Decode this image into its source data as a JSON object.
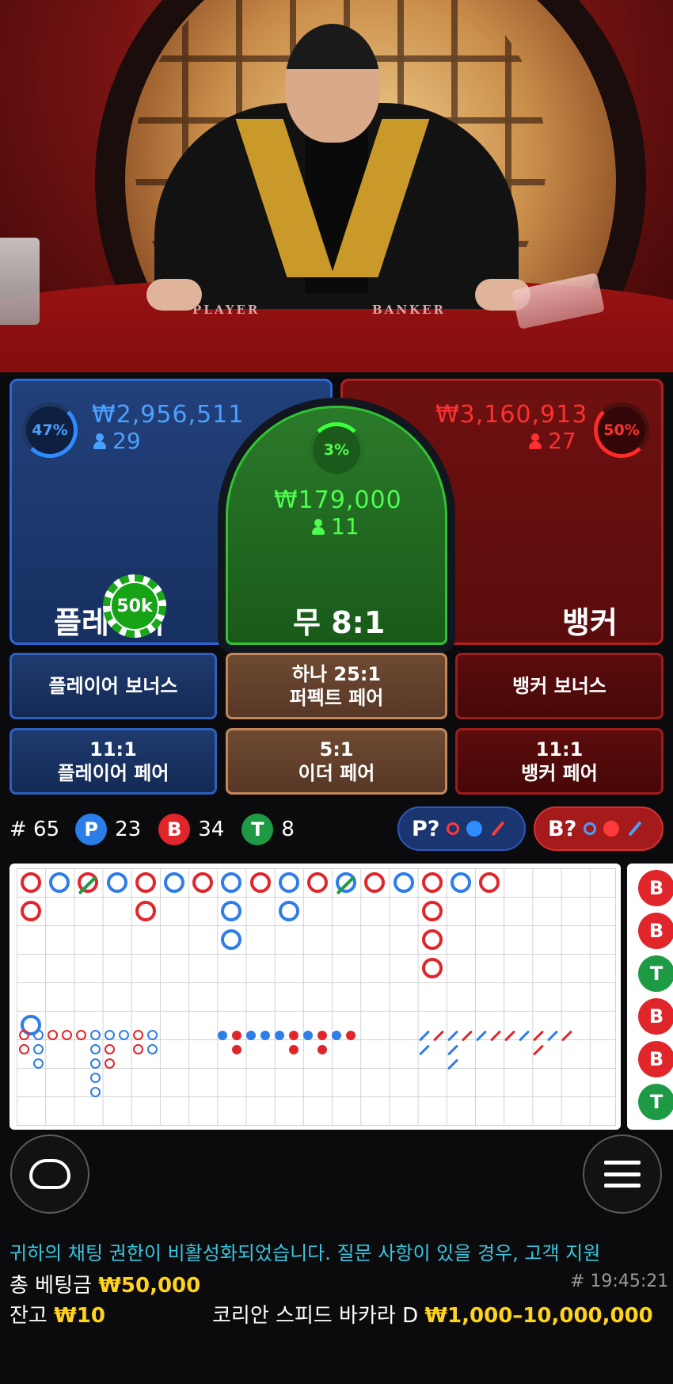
{
  "table_labels": {
    "player": "PLAYER",
    "banker": "BANKER"
  },
  "player": {
    "percent": "47%",
    "amount": "₩2,956,511",
    "players": "29",
    "label": "플레이어",
    "chip": "50k",
    "color": "#2f66d6"
  },
  "tie": {
    "percent": "3%",
    "amount": "₩179,000",
    "players": "11",
    "label": "무 8:1",
    "color": "#32c232"
  },
  "banker": {
    "percent": "50%",
    "amount": "₩3,160,913",
    "players": "27",
    "label": "뱅커",
    "color": "#b0201e"
  },
  "side_bets": {
    "player_bonus": "플레이어 보너스",
    "perfect_pair_odds": "하나 25:1",
    "perfect_pair": "퍼펙트 페어",
    "banker_bonus": "뱅커 보너스",
    "player_pair_odds": "11:1",
    "player_pair": "플레이어 페어",
    "either_pair_odds": "5:1",
    "either_pair": "이더 페어",
    "banker_pair_odds": "11:1",
    "banker_pair": "뱅커 페어"
  },
  "stats": {
    "round": "# 65",
    "p_letter": "P",
    "p_count": "23",
    "b_letter": "B",
    "b_count": "34",
    "t_letter": "T",
    "t_count": "8"
  },
  "predictions": {
    "player": "P?",
    "banker": "B?"
  },
  "road_side": [
    "B",
    "B",
    "T",
    "B",
    "B",
    "T"
  ],
  "chat_message": "귀하의 채팅 권한이 비활성화되었습니다. 질문 사항이 있을 경우, 고객 지원",
  "total_bet_label": "총 베팅금",
  "total_bet": "₩50,000",
  "balance_label": "잔고",
  "balance": "₩10",
  "round_id": "# 19:45:21",
  "table_name": "코리안 스피드 바카라 D",
  "bet_limits": "₩1,000–10,000,000"
}
